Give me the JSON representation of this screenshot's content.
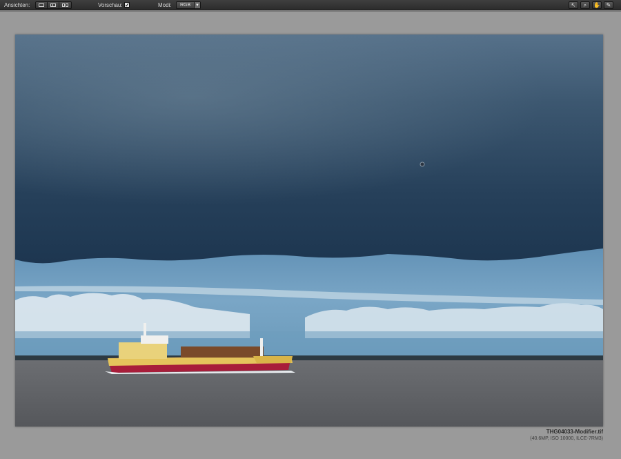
{
  "toolbar": {
    "views_label": "Ansichten:",
    "preview_label": "Vorschau:",
    "preview_checked": "✓",
    "mode_label": "Modi:",
    "mode_value": "RGB",
    "tools": [
      {
        "icon": "pointer-icon",
        "glyph": "↖"
      },
      {
        "icon": "zoom-icon",
        "glyph": "⌕"
      },
      {
        "icon": "hand-icon",
        "glyph": "✋"
      },
      {
        "icon": "eyedropper-icon",
        "glyph": "✎"
      }
    ]
  },
  "image": {
    "description_colors": {
      "storm_cloud": "#1e3a52",
      "sky_light": "#6f9bbd",
      "water": "#5e6066",
      "ship_hull": "#b01e3a",
      "ship_body": "#e7c55b"
    }
  },
  "caption": {
    "filename": "THG04033-Modifier.tif",
    "details": "(40.6MP, ISO 10000, ILCE-7RM3)"
  }
}
